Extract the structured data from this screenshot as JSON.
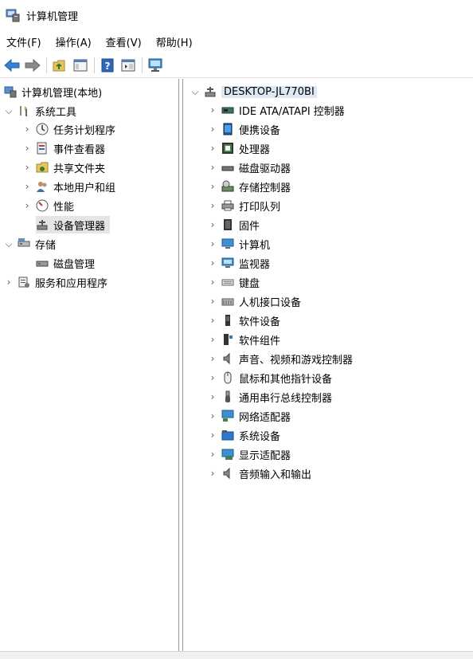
{
  "window": {
    "title": "计算机管理"
  },
  "menu": [
    "文件(F)",
    "操作(A)",
    "查看(V)",
    "帮助(H)"
  ],
  "toolbar": {
    "buttons": [
      "back-arrow-icon",
      "forward-arrow-icon",
      "up-folder-icon",
      "show-hide-tree-icon",
      "help-icon",
      "show-hide-action-pane-icon",
      "monitor-icon"
    ]
  },
  "left_tree": {
    "root": "计算机管理(本地)",
    "system_tools": "系统工具",
    "system_children": [
      "任务计划程序",
      "事件查看器",
      "共享文件夹",
      "本地用户和组",
      "性能",
      "设备管理器"
    ],
    "storage": "存储",
    "storage_children": [
      "磁盘管理"
    ],
    "services": "服务和应用程序"
  },
  "device_tree": {
    "host": "DESKTOP-JL770BI",
    "categories": [
      "IDE ATA/ATAPI 控制器",
      "便携设备",
      "处理器",
      "磁盘驱动器",
      "存储控制器",
      "打印队列",
      "固件",
      "计算机",
      "监视器",
      "键盘",
      "人机接口设备",
      "软件设备",
      "软件组件",
      "声音、视频和游戏控制器",
      "鼠标和其他指针设备",
      "通用串行总线控制器",
      "网络适配器",
      "系统设备",
      "显示适配器",
      "音频输入和输出"
    ]
  }
}
